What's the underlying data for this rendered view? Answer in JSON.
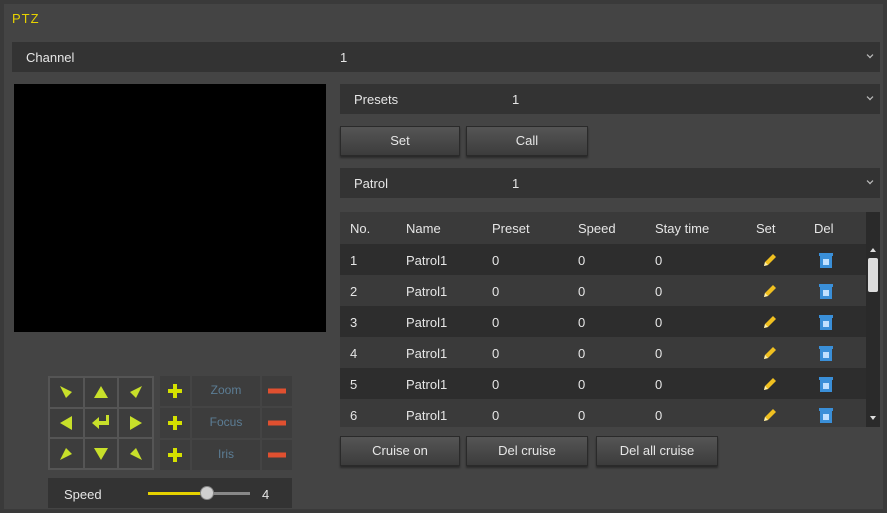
{
  "title": "PTZ",
  "channel": {
    "label": "Channel",
    "value": "1"
  },
  "presets": {
    "label": "Presets",
    "value": "1",
    "set_label": "Set",
    "call_label": "Call"
  },
  "patrol": {
    "label": "Patrol",
    "value": "1"
  },
  "table": {
    "headers": [
      "No.",
      "Name",
      "Preset",
      "Speed",
      "Stay time",
      "Set",
      "Del"
    ],
    "rows": [
      {
        "no": "1",
        "name": "Patrol1",
        "preset": "0",
        "speed": "0",
        "stay": "0"
      },
      {
        "no": "2",
        "name": "Patrol1",
        "preset": "0",
        "speed": "0",
        "stay": "0"
      },
      {
        "no": "3",
        "name": "Patrol1",
        "preset": "0",
        "speed": "0",
        "stay": "0"
      },
      {
        "no": "4",
        "name": "Patrol1",
        "preset": "0",
        "speed": "0",
        "stay": "0"
      },
      {
        "no": "5",
        "name": "Patrol1",
        "preset": "0",
        "speed": "0",
        "stay": "0"
      },
      {
        "no": "6",
        "name": "Patrol1",
        "preset": "0",
        "speed": "0",
        "stay": "0"
      }
    ]
  },
  "buttons": {
    "cruise_on": "Cruise on",
    "del_cruise": "Del cruise",
    "del_all_cruise": "Del all cruise"
  },
  "lens": {
    "zoom": "Zoom",
    "focus": "Focus",
    "iris": "Iris"
  },
  "speed": {
    "label": "Speed",
    "value": "4",
    "level_fraction": 0.6
  },
  "colors": {
    "accent": "#e6d200",
    "arrow": "#c8e02a",
    "plus": "#d4e000",
    "minus": "#e05030",
    "delete_icon": "#3a8fd8",
    "edit_icon": "#f0c020"
  }
}
